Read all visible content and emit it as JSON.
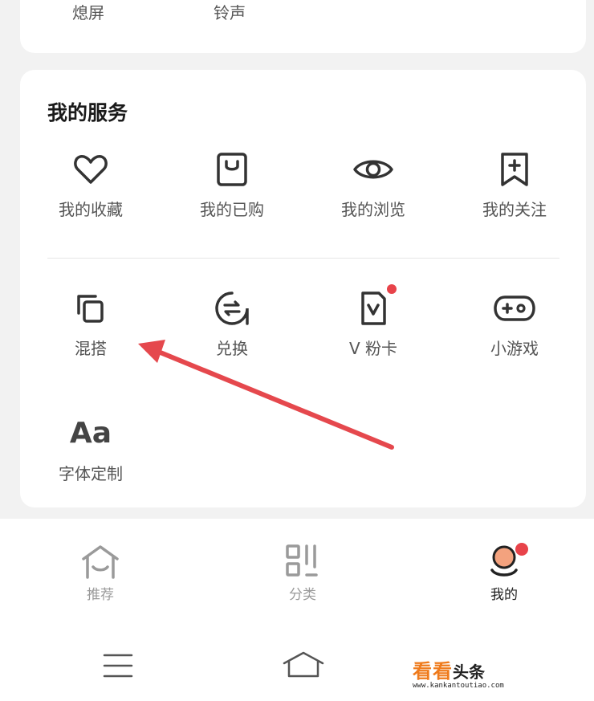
{
  "top_card": {
    "items": [
      "熄屏",
      "铃声"
    ]
  },
  "services": {
    "title": "我的服务",
    "row1": [
      {
        "label": "我的收藏",
        "icon": "heart-icon"
      },
      {
        "label": "我的已购",
        "icon": "shopping-bag-icon"
      },
      {
        "label": "我的浏览",
        "icon": "eye-icon"
      },
      {
        "label": "我的关注",
        "icon": "bookmark-plus-icon"
      }
    ],
    "row2": [
      {
        "label": "混搭",
        "icon": "copy-icon"
      },
      {
        "label": "兑换",
        "icon": "exchange-icon"
      },
      {
        "label": "V 粉卡",
        "icon": "v-card-icon",
        "badge": true
      },
      {
        "label": "小游戏",
        "icon": "gamepad-icon"
      }
    ],
    "row3": [
      {
        "label": "字体定制",
        "icon_text": "Aa"
      }
    ]
  },
  "tabbar": [
    {
      "label": "推荐",
      "icon": "home-icon",
      "active": false
    },
    {
      "label": "分类",
      "icon": "grid-icon",
      "active": false
    },
    {
      "label": "我的",
      "icon": "profile-icon",
      "active": true,
      "badge": true
    }
  ],
  "watermark": {
    "text1": "看看",
    "text2": "头条",
    "url": "www.kankantoutiao.com"
  },
  "colors": {
    "badge": "#e8434a",
    "arrow": "#e5484d",
    "watermark": "#ef7b1c",
    "inactive_tab": "#9a9a9a"
  }
}
